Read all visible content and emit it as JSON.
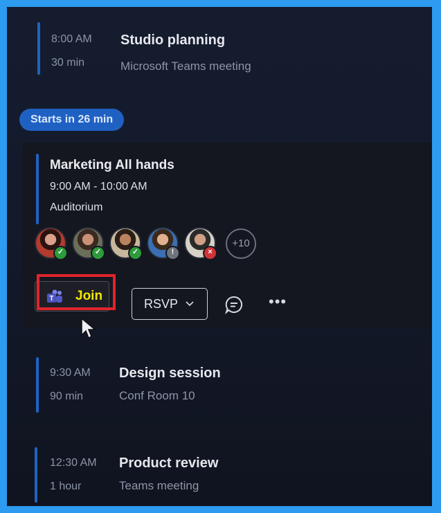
{
  "events_before": [
    {
      "time": "8:00 AM",
      "duration": "30 min",
      "title": "Studio planning",
      "subtitle": "Microsoft Teams meeting"
    }
  ],
  "upcoming_badge": "Starts in 26 min",
  "featured": {
    "title": "Marketing All hands",
    "time_range": "9:00 AM - 10:00 AM",
    "location": "Auditorium",
    "attendees": [
      {
        "status": "accepted",
        "status_icon": "check-icon",
        "color": "#2d9b3a"
      },
      {
        "status": "accepted",
        "status_icon": "check-icon",
        "color": "#2d9b3a"
      },
      {
        "status": "accepted",
        "status_icon": "check-icon",
        "color": "#2d9b3a"
      },
      {
        "status": "tentative",
        "status_icon": "exclamation-icon",
        "color": "#6f737d"
      },
      {
        "status": "declined",
        "status_icon": "x-icon",
        "color": "#d13438"
      }
    ],
    "more_attendees": "+10",
    "join_label": "Join",
    "rsvp_label": "RSVP",
    "chat_icon": "chat-icon",
    "more_icon": "more-options-icon"
  },
  "events_after": [
    {
      "time": "9:30 AM",
      "duration": "90 min",
      "title": "Design session",
      "subtitle": "Conf Room 10"
    },
    {
      "time": "12:30 AM",
      "duration": "1 hour",
      "title": "Product review",
      "subtitle": "Teams meeting"
    }
  ],
  "colors": {
    "accent": "#1f61c2",
    "join_text": "#f2e600",
    "highlight": "#e1242b",
    "frame": "#2d9bf0"
  }
}
